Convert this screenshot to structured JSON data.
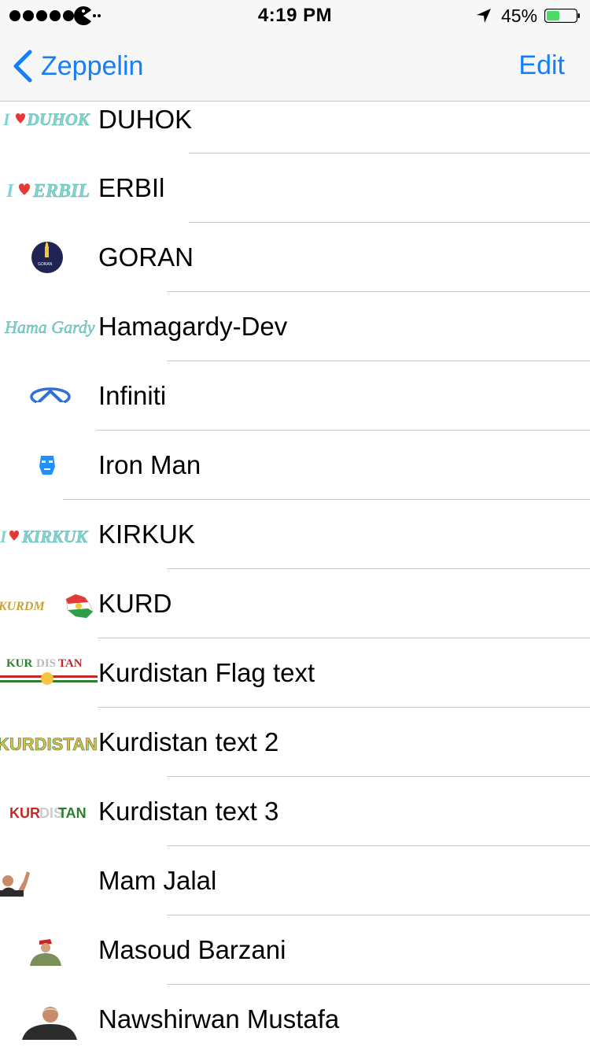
{
  "status_bar": {
    "signal_bars": 5,
    "time": "4:19 PM",
    "battery_percent": "45%",
    "battery_level": 0.45,
    "icons": [
      "signal-dots-icon",
      "carrier-pacman-icon",
      "location-arrow-icon",
      "battery-icon"
    ]
  },
  "nav": {
    "back_label": "Zeppelin",
    "edit_label": "Edit",
    "tint_color": "#157efb"
  },
  "rows": [
    {
      "label": "DUHOK",
      "thumb_icon": "i-love-duhok-thumbnail"
    },
    {
      "label": "ERBIl",
      "thumb_icon": "i-love-erbil-thumbnail"
    },
    {
      "label": "GORAN",
      "thumb_icon": "goran-logo-thumbnail"
    },
    {
      "label": "Hamagardy-Dev",
      "thumb_icon": "hama-gardy-script-thumbnail"
    },
    {
      "label": "Infiniti",
      "thumb_icon": "infiniti-logo-thumbnail"
    },
    {
      "label": "Iron Man",
      "thumb_icon": "iron-man-helmet-thumbnail"
    },
    {
      "label": "KIRKUK",
      "thumb_icon": "i-love-kirkuk-thumbnail"
    },
    {
      "label": "KURD",
      "thumb_icon": "kurd-map-thumbnail"
    },
    {
      "label": "Kurdistan Flag text",
      "thumb_icon": "kurdistan-flag-text-thumbnail"
    },
    {
      "label": "Kurdistan text 2",
      "thumb_icon": "kurdistan-text-2-thumbnail"
    },
    {
      "label": "Kurdistan text 3",
      "thumb_icon": "kurdistan-text-3-thumbnail"
    },
    {
      "label": "Mam Jalal",
      "thumb_icon": "mam-jalal-photo-thumbnail"
    },
    {
      "label": "Masoud Barzani",
      "thumb_icon": "masoud-barzani-photo-thumbnail"
    },
    {
      "label": "Nawshirwan Mustafa",
      "thumb_icon": "nawshirwan-mustafa-photo-thumbnail"
    }
  ]
}
